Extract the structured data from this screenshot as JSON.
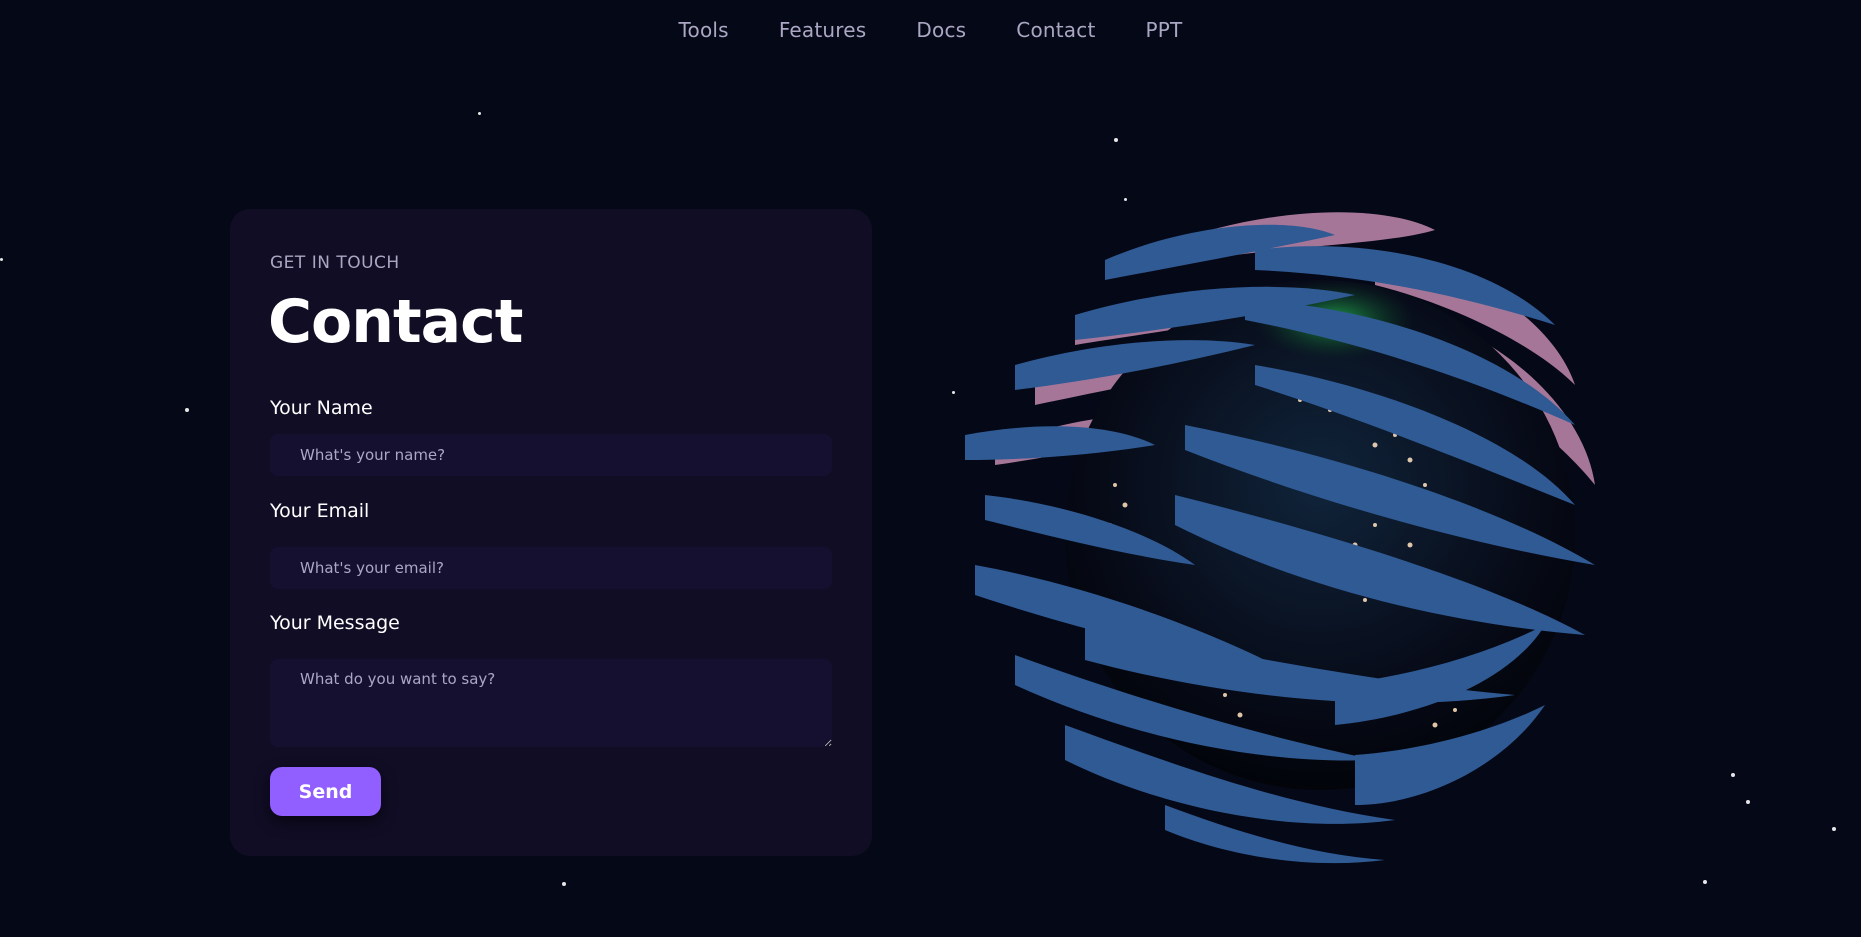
{
  "nav": {
    "items": [
      "Tools",
      "Features",
      "Docs",
      "Contact",
      "PPT"
    ]
  },
  "contact": {
    "eyebrow": "GET IN TOUCH",
    "title": "Contact",
    "name_label": "Your Name",
    "name_placeholder": "What's your name?",
    "email_label": "Your Email",
    "email_placeholder": "What's your email?",
    "message_label": "Your Message",
    "message_placeholder": "What do you want to say?",
    "send_label": "Send"
  },
  "colors": {
    "background": "#050816",
    "card": "#100d25",
    "input": "#151030",
    "accent": "#915eff",
    "secondary_text": "#aaa6c3"
  },
  "scene": {
    "object": "3D globe with blue and pink cloud bands"
  }
}
